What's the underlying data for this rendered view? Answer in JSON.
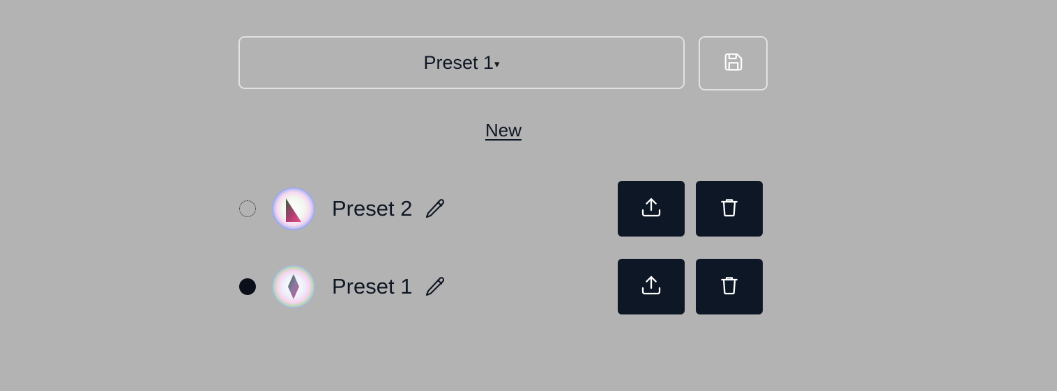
{
  "preset_select": {
    "selected": "Preset 1",
    "caret": "▾"
  },
  "save_button": {
    "icon": "save-icon"
  },
  "new_link": "New",
  "presets": [
    {
      "name": "Preset 2",
      "selected": false,
      "avatar_icon": "preset-thumbnail",
      "actions": [
        "export-icon",
        "trash-icon"
      ]
    },
    {
      "name": "Preset 1",
      "selected": true,
      "avatar_icon": "preset-thumbnail",
      "actions": [
        "export-icon",
        "trash-icon"
      ]
    }
  ],
  "colors": {
    "background": "#b3b3b3",
    "button_dark": "#0e1726",
    "text": "#0f1724",
    "outline": "#e2e2e2"
  }
}
